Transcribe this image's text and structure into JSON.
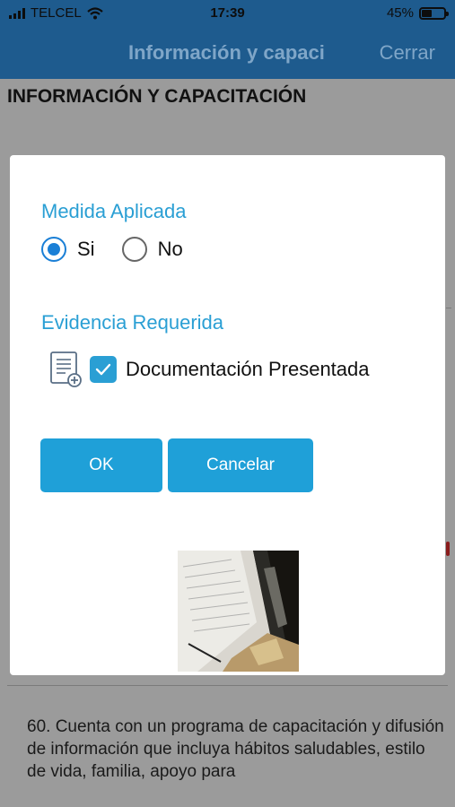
{
  "status_bar": {
    "carrier": "TELCEL",
    "time": "17:39",
    "battery_percent": "45%",
    "battery_level": 0.45
  },
  "nav": {
    "title": "Información y capaci",
    "close_label": "Cerrar"
  },
  "page": {
    "heading": "INFORMACIÓN Y CAPACITACIÓN",
    "question_text": "60. Cuenta con un programa de capacitación y difusión de información que incluya hábitos saludables, estilo de vida, familia, apoyo para"
  },
  "dialog": {
    "measure_label": "Medida Aplicada",
    "options": [
      {
        "label": "Si",
        "selected": true
      },
      {
        "label": "No",
        "selected": false
      }
    ],
    "evidence_label": "Evidencia Requerida",
    "evidence": {
      "label": "Documentación Presentada",
      "checked": true,
      "icon": "document-add-icon"
    },
    "ok_label": "OK",
    "cancel_label": "Cancelar"
  },
  "colors": {
    "nav_bg": "#1e5b8e",
    "accent": "#2a9fd4",
    "button": "#1fa0d8",
    "radio_selected": "#1a7fd6",
    "overlay": "#9b9b9b"
  }
}
